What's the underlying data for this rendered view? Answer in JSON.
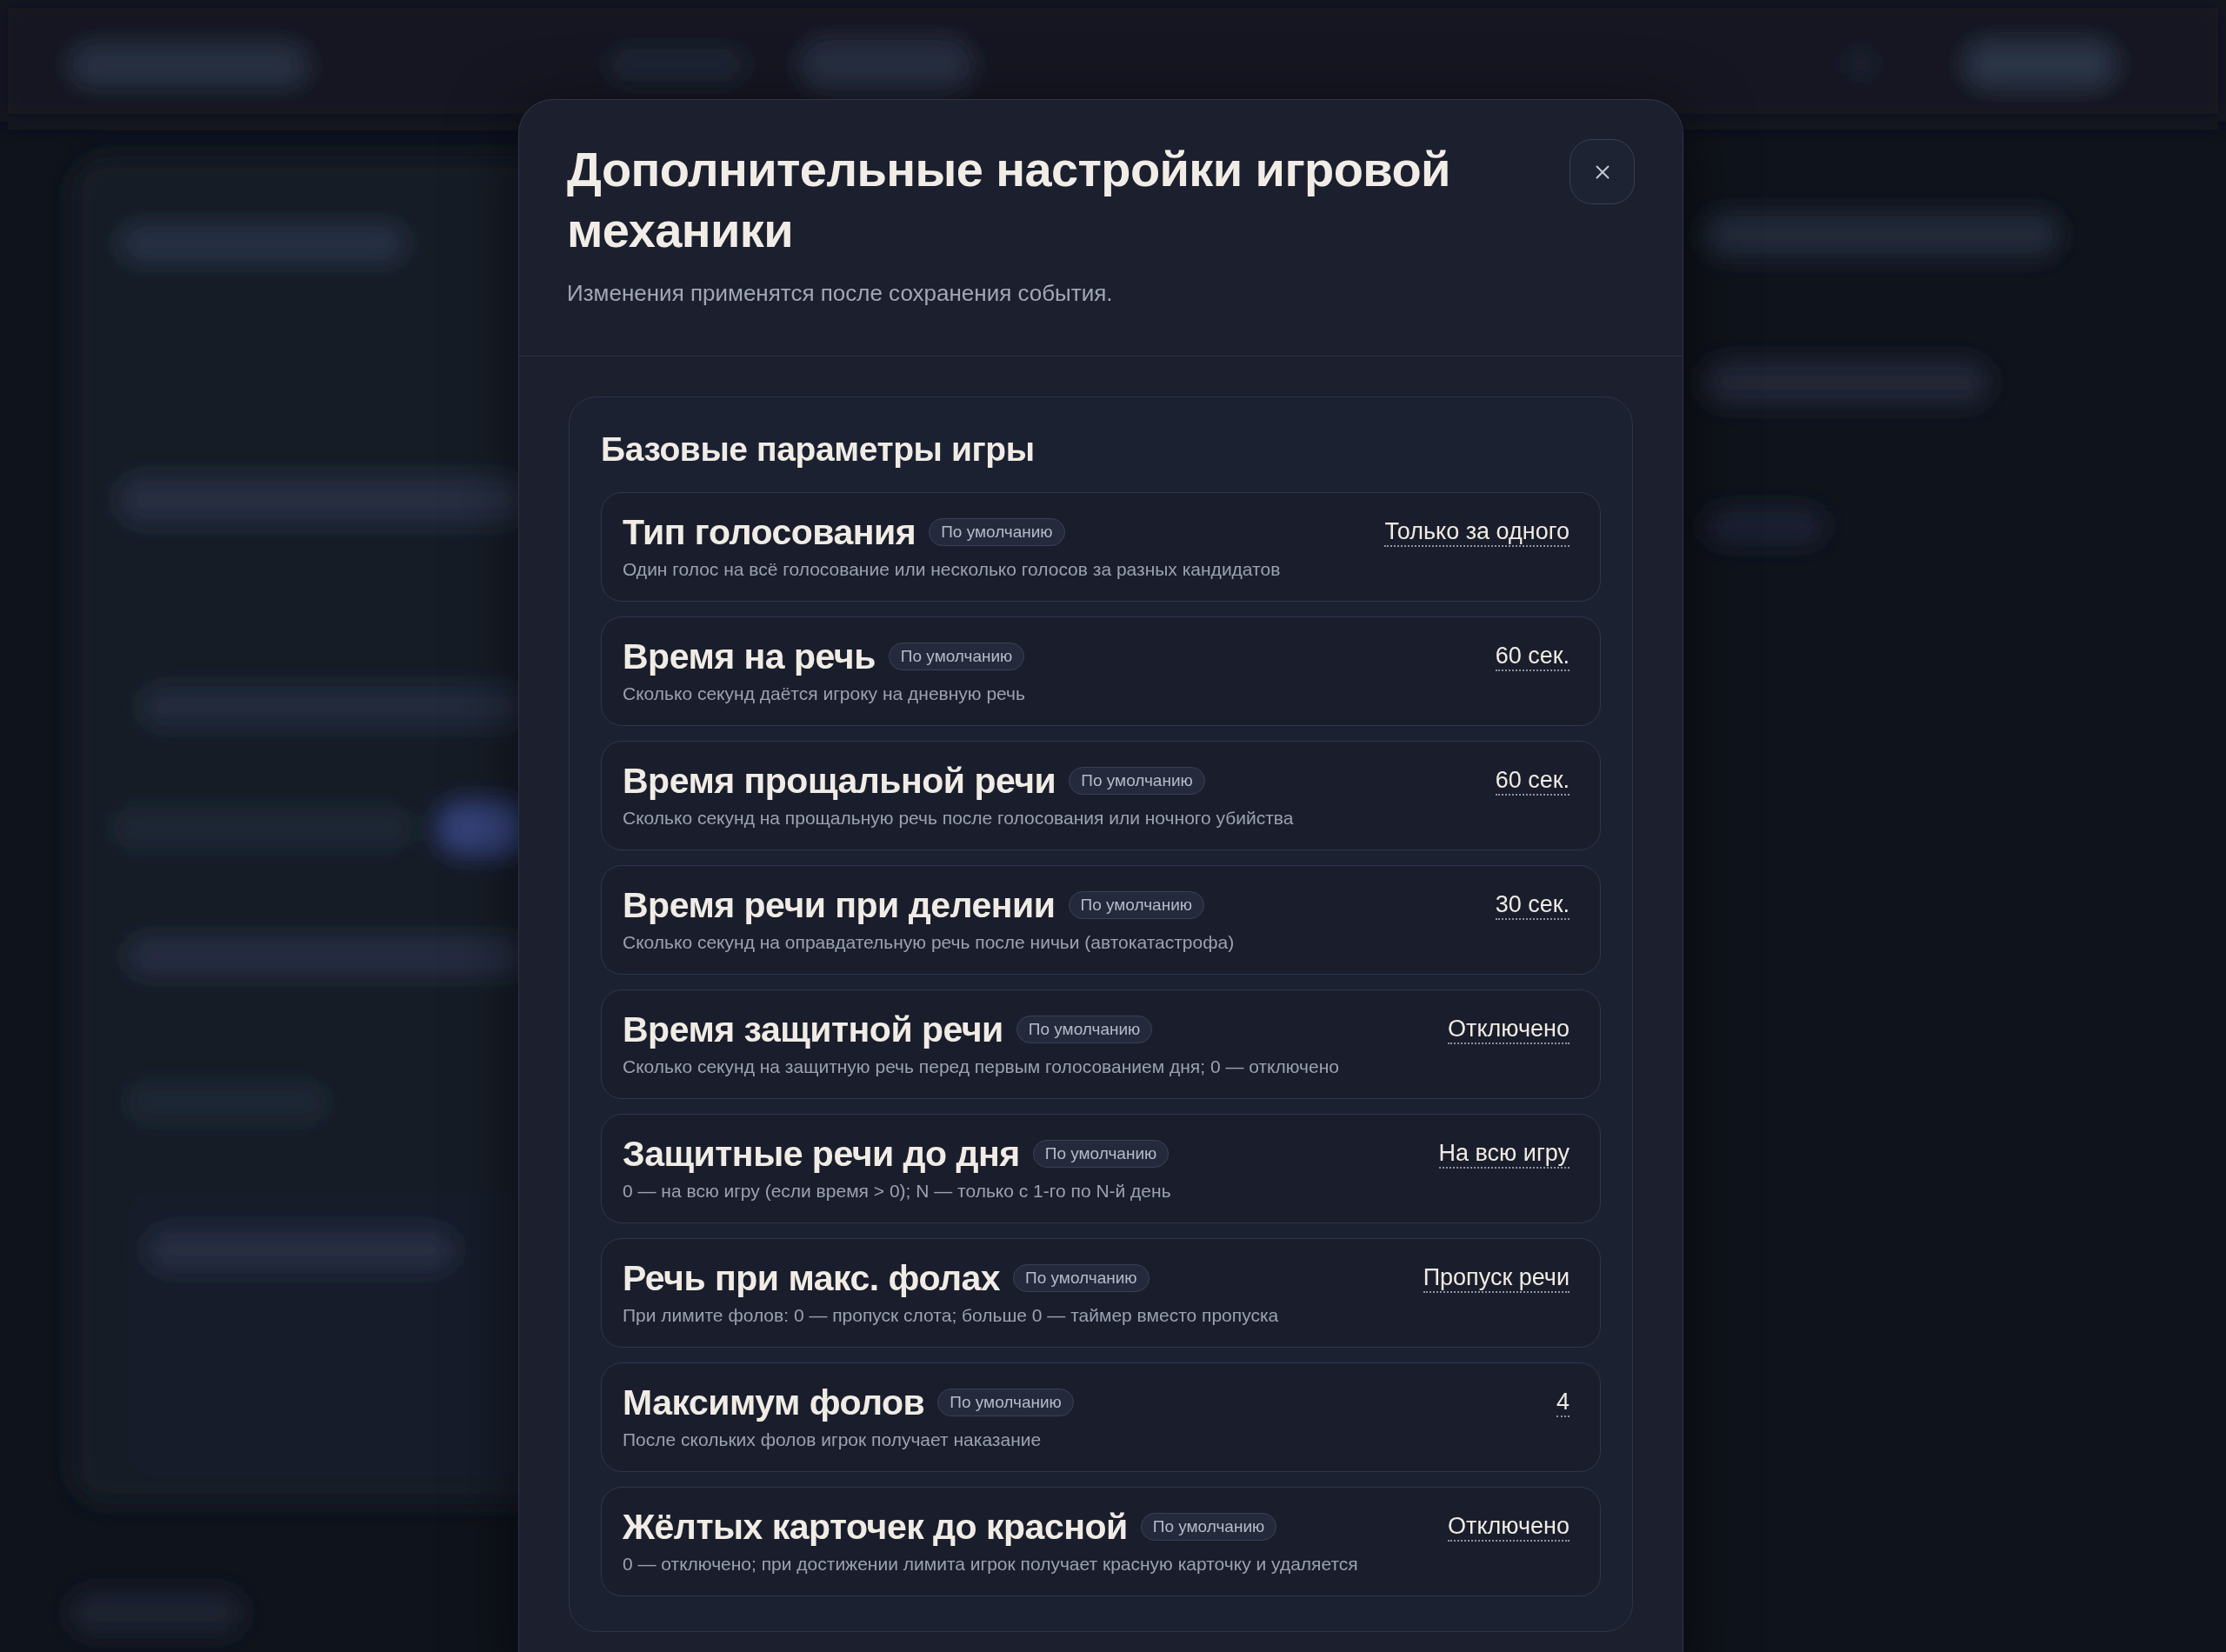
{
  "dialog": {
    "title": "Дополнительные настройки игровой механики",
    "subtitle": "Изменения применятся после сохранения события."
  },
  "sections": [
    {
      "title": "Базовые параметры игры",
      "settings": [
        {
          "name": "Тип голосования",
          "badge": "По умолчанию",
          "description": "Один голос на всё голосование или несколько голосов за разных кандидатов",
          "value": "Только за одного"
        },
        {
          "name": "Время на речь",
          "badge": "По умолчанию",
          "description": "Сколько секунд даётся игроку на дневную речь",
          "value": "60 сек."
        },
        {
          "name": "Время прощальной речи",
          "badge": "По умолчанию",
          "description": "Сколько секунд на прощальную речь после голосования или ночного убийства",
          "value": "60 сек."
        },
        {
          "name": "Время речи при делении",
          "badge": "По умолчанию",
          "description": "Сколько секунд на оправдательную речь после ничьи (автокатастрофа)",
          "value": "30 сек."
        },
        {
          "name": "Время защитной речи",
          "badge": "По умолчанию",
          "description": "Сколько секунд на защитную речь перед первым голосованием дня; 0 — отключено",
          "value": "Отключено"
        },
        {
          "name": "Защитные речи до дня",
          "badge": "По умолчанию",
          "description": "0 — на всю игру (если время > 0); N — только с 1-го по N-й день",
          "value": "На всю игру"
        },
        {
          "name": "Речь при макс. фолах",
          "badge": "По умолчанию",
          "description": "При лимите фолов: 0 — пропуск слота; больше 0 — таймер вместо пропуска",
          "value": "Пропуск речи"
        },
        {
          "name": "Максимум фолов",
          "badge": "По умолчанию",
          "description": "После скольких фолов игрок получает наказание",
          "value": "4"
        },
        {
          "name": "Жёлтых карточек до красной",
          "badge": "По умолчанию",
          "description": "0 — отключено; при достижении лимита игрок получает красную карточку и удаляется",
          "value": "Отключено"
        }
      ]
    }
  ]
}
